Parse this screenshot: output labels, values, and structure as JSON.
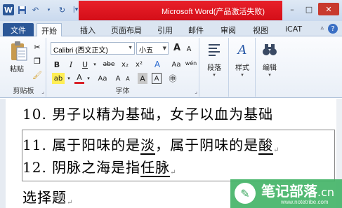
{
  "titlebar": {
    "title": "Microsoft Word(产品激活失败)",
    "minimize": "–",
    "maximize": "□",
    "close": "✕"
  },
  "tabs": [
    "文件",
    "开始",
    "插入",
    "页面布局",
    "引用",
    "邮件",
    "审阅",
    "视图",
    "iCAT"
  ],
  "ribbon": {
    "clipboard": {
      "paste_label": "粘贴",
      "group_label": "剪贴板"
    },
    "font": {
      "font_name": "Calibri (西文正文)",
      "font_size": "小五",
      "grow": "A",
      "shrink": "A",
      "clear_format": "Aa",
      "wen": "wén",
      "group_label": "字体",
      "bold": "B",
      "italic": "I",
      "underline": "U",
      "strike": "abe",
      "sub": "x₂",
      "sup": "x²",
      "font_color": "A",
      "case": "Aa",
      "char_shading": "A",
      "char_border": "A"
    },
    "paragraph": {
      "label": "段落"
    },
    "styles": {
      "label": "样式"
    },
    "editing": {
      "label": "编辑"
    }
  },
  "document": {
    "line_top_partial": "10. 男子以精为基础，女子以血为基础",
    "line11_prefix": "11. 属于阳味的是",
    "line11_u1": "淡",
    "line11_mid": "，属于阴味的是",
    "line11_u2": "酸",
    "line12_prefix": "12. 阴脉之海是指",
    "line12_u": "任脉",
    "section_title": "选择题"
  },
  "watermark": {
    "text": "笔记部落",
    "suffix": ".cn",
    "url": "www.notetribe.com"
  },
  "colors": {
    "title_red": "#e8202a",
    "file_tab": "#2b5797",
    "watermark_green": "#44b468"
  }
}
